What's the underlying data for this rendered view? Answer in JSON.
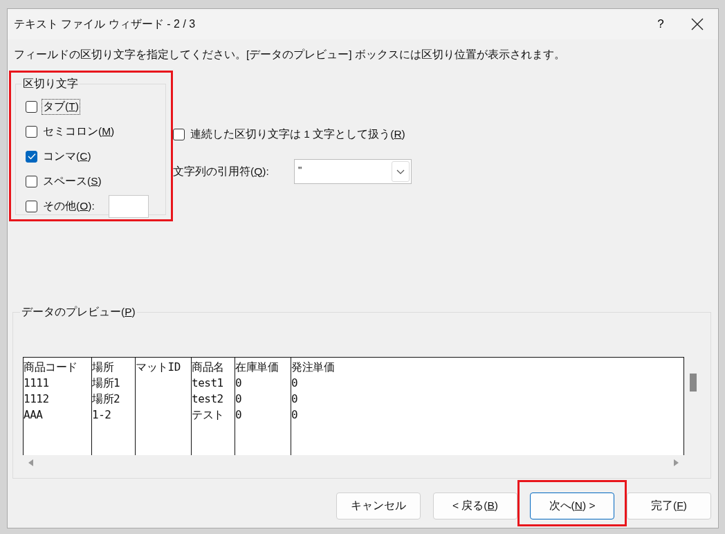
{
  "window": {
    "title": "テキスト ファイル ウィザード - 2 / 3",
    "help": "?"
  },
  "instruction": "フィールドの区切り文字を指定してください。[データのプレビュー] ボックスには区切り位置が表示されます。",
  "delimiters": {
    "title": "区切り文字",
    "highlighted": true,
    "items": [
      {
        "label_start": "タブ(",
        "access_key": "T",
        "label_end": ")",
        "checked": false,
        "focused": true
      },
      {
        "label_start": "セミコロン(",
        "access_key": "M",
        "label_end": ")",
        "checked": false,
        "focused": false
      },
      {
        "label_start": "コンマ(",
        "access_key": "C",
        "label_end": ")",
        "checked": true,
        "focused": false
      },
      {
        "label_start": "スペース(",
        "access_key": "S",
        "label_end": ")",
        "checked": false,
        "focused": false
      },
      {
        "label_start": "その他(",
        "access_key": "O",
        "label_end": "):",
        "checked": false,
        "focused": false,
        "kind": "with-field"
      }
    ]
  },
  "consecutive": {
    "label_start": "連続した区切り文字は 1 文字として扱う(",
    "access_key": "R",
    "label_end": ")",
    "checked": false
  },
  "text_qualifier": {
    "label_start": "文字列の引用符(",
    "access_key": "Q",
    "label_end": "):",
    "value": "\""
  },
  "preview": {
    "label_start": "データのプレビュー(",
    "access_key": "P",
    "label_end": ")",
    "rows": [
      [
        "商品コード",
        "場所",
        "マットID",
        "商品名",
        "在庫単価",
        "発注単価"
      ],
      [
        "1111",
        "場所1",
        null,
        "test1",
        "0",
        "0"
      ],
      [
        "1112",
        "場所2",
        null,
        "test2",
        "0",
        "0"
      ],
      [
        "AAA",
        "1-2",
        null,
        "テスト",
        "0",
        "0"
      ]
    ]
  },
  "buttons": [
    {
      "label_start": "キャンセル",
      "default": false,
      "highlighted": false
    },
    {
      "label_start": "< 戻る(",
      "access_key": "B",
      "label_end": ")",
      "default": false,
      "highlighted": false
    },
    {
      "label_start": "次へ(",
      "access_key": "N",
      "label_end": ") >",
      "default": true,
      "highlighted": true
    },
    {
      "label_start": "完了(",
      "access_key": "F",
      "label_end": ")",
      "default": false,
      "highlighted": false
    }
  ]
}
